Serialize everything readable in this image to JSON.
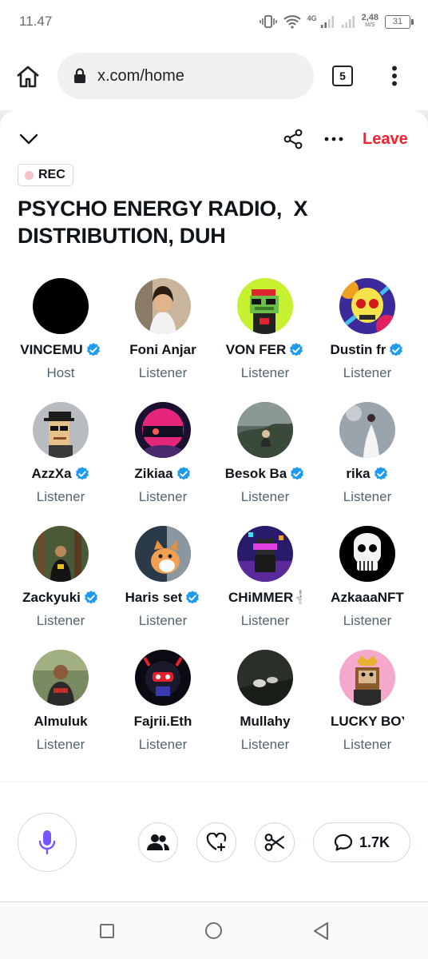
{
  "status_bar": {
    "time": "11.47",
    "network_type": "4G",
    "speed_value": "2,48",
    "speed_unit": "M/S",
    "battery": "31"
  },
  "browser": {
    "url": "x.com/home",
    "tab_count": "5",
    "icons": [
      "home-icon",
      "lock-icon",
      "more-vertical-icon"
    ]
  },
  "space": {
    "leave_label": "Leave",
    "rec_label": "REC",
    "title": "PSYCHO ENERGY RADIO,  X DISTRIBUTION, DUH",
    "accent_color": "#f4212e",
    "verified_color": "#1d9bf0",
    "participants": [
      {
        "name": "VINCEMU",
        "role": "Host",
        "verified": true,
        "avatar": "black-circle"
      },
      {
        "name": "Foni Anjar",
        "role": "Listener",
        "verified": false,
        "avatar": "photo-woman"
      },
      {
        "name": "VON FER",
        "role": "Listener",
        "verified": true,
        "avatar": "pixel-frog"
      },
      {
        "name": "Dustin fr",
        "role": "Listener",
        "verified": true,
        "avatar": "colorful-skull"
      },
      {
        "name": "AzzXa",
        "role": "Listener",
        "verified": true,
        "avatar": "pixel-punk"
      },
      {
        "name": "Zikiaa",
        "role": "Listener",
        "verified": true,
        "avatar": "pink-helmet"
      },
      {
        "name": "Besok Ba",
        "role": "Listener",
        "verified": true,
        "avatar": "photo-nature"
      },
      {
        "name": "rika",
        "role": "Listener",
        "verified": true,
        "avatar": "photo-white-dress"
      },
      {
        "name": "Zackyuki",
        "role": "Listener",
        "verified": true,
        "avatar": "photo-forest-man"
      },
      {
        "name": "Haris set",
        "role": "Listener",
        "verified": true,
        "avatar": "photo-cat"
      },
      {
        "name": "CHiMMER🐇",
        "role": "Listener",
        "verified": false,
        "avatar": "pixel-vr"
      },
      {
        "name": "AzkaaaNFT",
        "role": "Listener",
        "verified": false,
        "avatar": "ape-skull"
      },
      {
        "name": "Almuluk",
        "role": "Listener",
        "verified": false,
        "avatar": "photo-man"
      },
      {
        "name": "Fajrii.Eth",
        "role": "Listener",
        "verified": false,
        "avatar": "red-robot"
      },
      {
        "name": "Mullahy",
        "role": "Listener",
        "verified": false,
        "avatar": "photo-dark"
      },
      {
        "name": "LUCKY BOY",
        "role": "Listener",
        "verified": false,
        "avatar": "pink-ape"
      }
    ]
  },
  "controls": {
    "comment_count": "1.7K",
    "mic_color": "#7856ff",
    "icons": [
      "microphone-icon",
      "people-icon",
      "heart-plus-icon",
      "scissors-icon",
      "comment-icon"
    ]
  }
}
